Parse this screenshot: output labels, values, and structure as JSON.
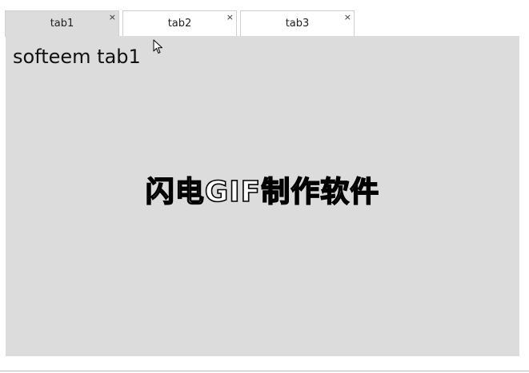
{
  "tabs": [
    {
      "label": "tab1",
      "close": "×",
      "active": true
    },
    {
      "label": "tab2",
      "close": "×",
      "active": false
    },
    {
      "label": "tab3",
      "close": "×",
      "active": false
    }
  ],
  "panel": {
    "title": "softeem tab1"
  },
  "watermark": "闪电GIF制作软件",
  "icons": {
    "close": "close-icon",
    "cursor": "mouse-cursor-icon"
  },
  "colors": {
    "active_tab_bg": "#dcdcdc",
    "inactive_tab_bg": "#ffffff",
    "panel_bg": "#dcdcdc",
    "tab_border": "#cfcfcf"
  }
}
